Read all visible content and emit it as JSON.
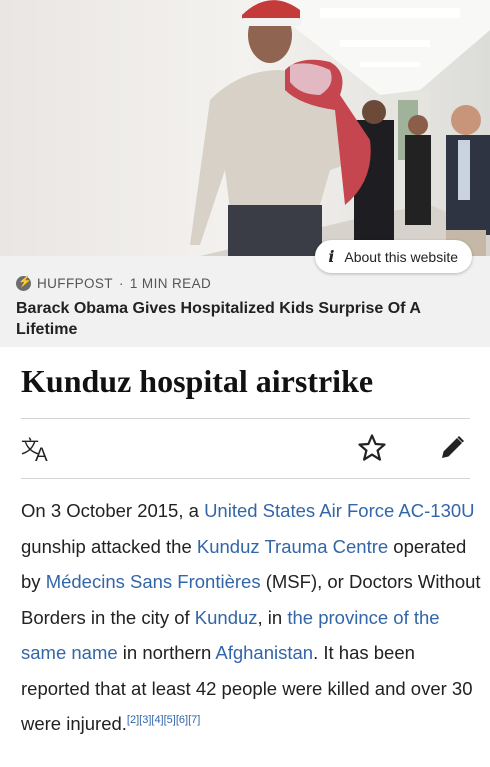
{
  "news_card": {
    "about_label": "About this website",
    "source": "HUFFPOST",
    "separator": "·",
    "read_time": "1 MIN READ",
    "headline": "Barack Obama Gives Hospitalized Kids Surprise Of A Lifetime"
  },
  "article": {
    "title": "Kunduz hospital airstrike",
    "summary": [
      {
        "text": "On 3 October 2015, a ",
        "link": false
      },
      {
        "text": "United States Air Force",
        "link": true
      },
      {
        "text": " ",
        "link": false
      },
      {
        "text": "AC-130U",
        "link": true
      },
      {
        "text": " gunship attacked the ",
        "link": false
      },
      {
        "text": "Kunduz Trauma Centre",
        "link": true
      },
      {
        "text": " operated by ",
        "link": false
      },
      {
        "text": "Médecins Sans Frontières",
        "link": true
      },
      {
        "text": " (MSF), or Doctors Without Borders in the city of ",
        "link": false
      },
      {
        "text": "Kunduz",
        "link": true
      },
      {
        "text": ", in ",
        "link": false
      },
      {
        "text": "the province of the same name",
        "link": true
      },
      {
        "text": " in northern ",
        "link": false
      },
      {
        "text": "Afghanistan",
        "link": true
      },
      {
        "text": ". It has been reported that at least 42 people were killed and over 30 were injured.",
        "link": false
      }
    ],
    "citations": "[2][3][4][5][6][7]"
  },
  "icons": {
    "translate": "language-icon",
    "watch": "star-icon",
    "edit": "pencil-icon",
    "info": "info-icon",
    "source_badge": "lightning-icon"
  },
  "colors": {
    "link": "#3366a8",
    "card_background": "#f1f1f1",
    "text": "#222222"
  }
}
